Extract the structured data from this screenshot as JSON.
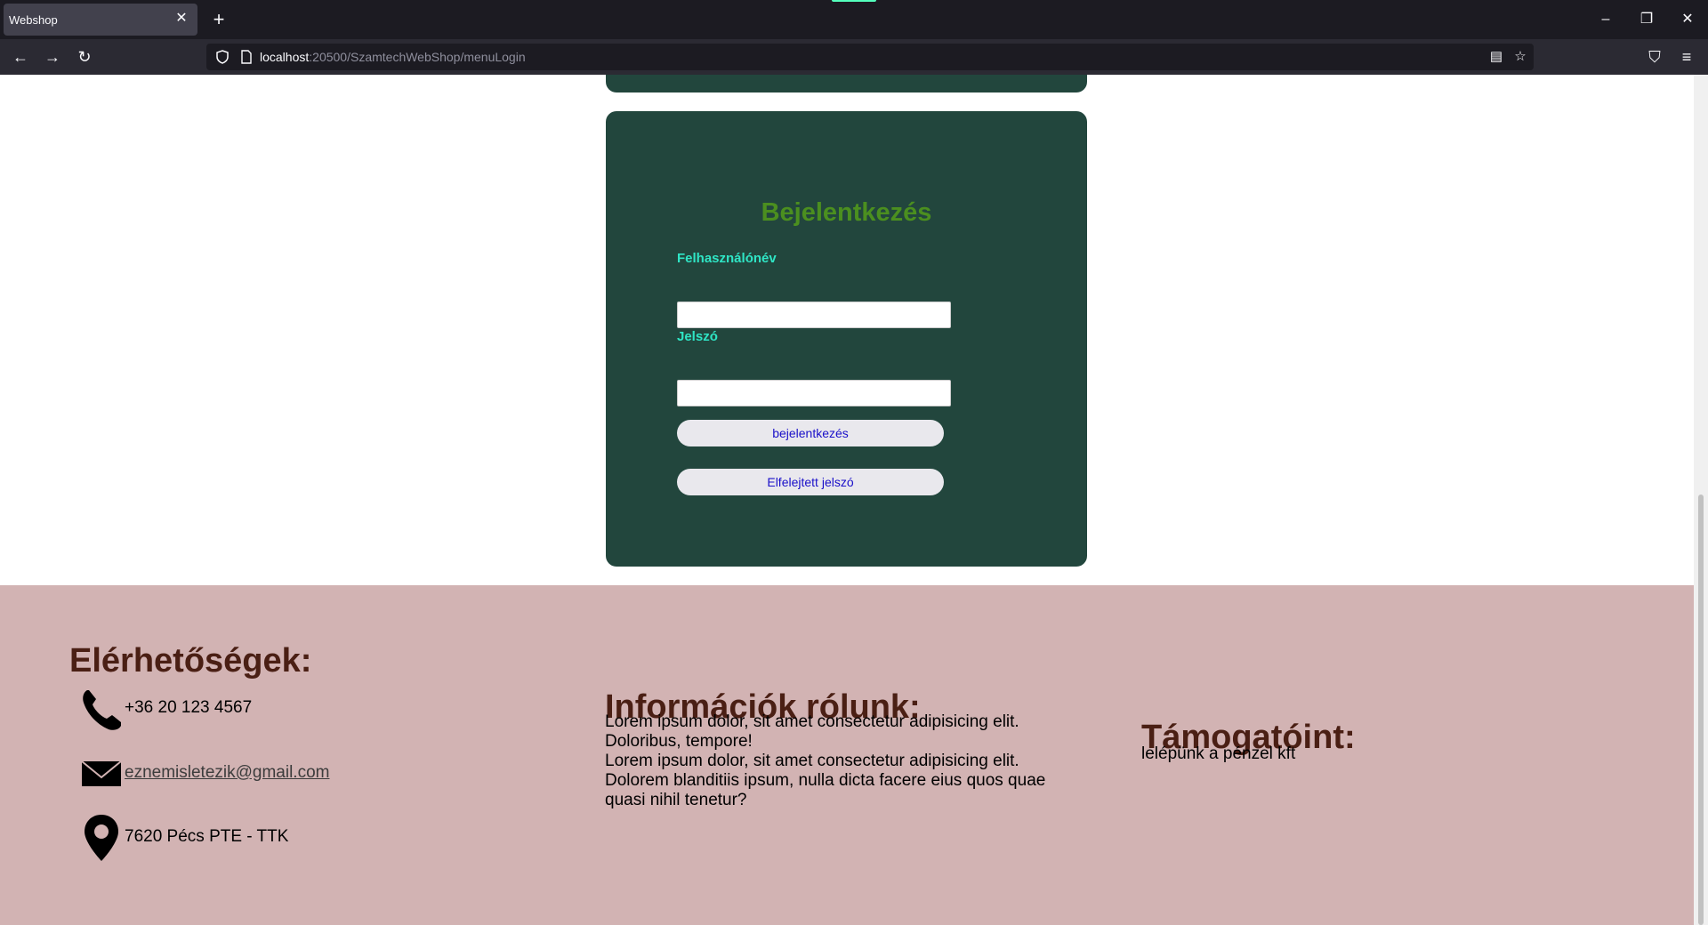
{
  "browser": {
    "tab_title": "Webshop",
    "new_tab_label": "+",
    "url_host": "localhost",
    "url_rest": ":20500/SzamtechWebShop/menuLogin"
  },
  "login": {
    "title": "Bejelentkezés",
    "username_label": "Felhasználónév",
    "username_value": "",
    "password_label": "Jelszó",
    "password_value": "",
    "login_button": "bejelentkezés",
    "forgot_button": "Elfelejtett jelszó"
  },
  "footer": {
    "contacts_title": "Elérhetőségek:",
    "phone": "+36 20 123 4567",
    "email": "eznemisletezik@gmail.com",
    "address": "7620 Pécs PTE - TTK",
    "info_title": "Információk rólunk:",
    "info_lines": [
      "Lorem ipsum dolor, sit amet consectetur adipisicing elit.",
      "Doloribus, tempore!",
      "Lorem ipsum dolor, sit amet consectetur adipisicing elit.",
      "Dolorem blanditiis ipsum, nulla dicta facere eius quos quae",
      "quasi nihil tenetur?"
    ],
    "sponsors_title": "Támogatóint:",
    "sponsors_text": "lelépünk a pénzel kft"
  },
  "colors": {
    "card_bg": "#22463d",
    "title_green": "#4b8f1f",
    "label_cyan": "#2fe5c5",
    "footer_bg": "#d2b3b3",
    "footer_heading": "#4a1f14"
  },
  "icons": [
    "shield-icon",
    "page-icon",
    "reader-icon",
    "star-icon",
    "pocket-icon",
    "menu-icon",
    "phone-icon",
    "mail-icon",
    "location-pin-icon"
  ]
}
